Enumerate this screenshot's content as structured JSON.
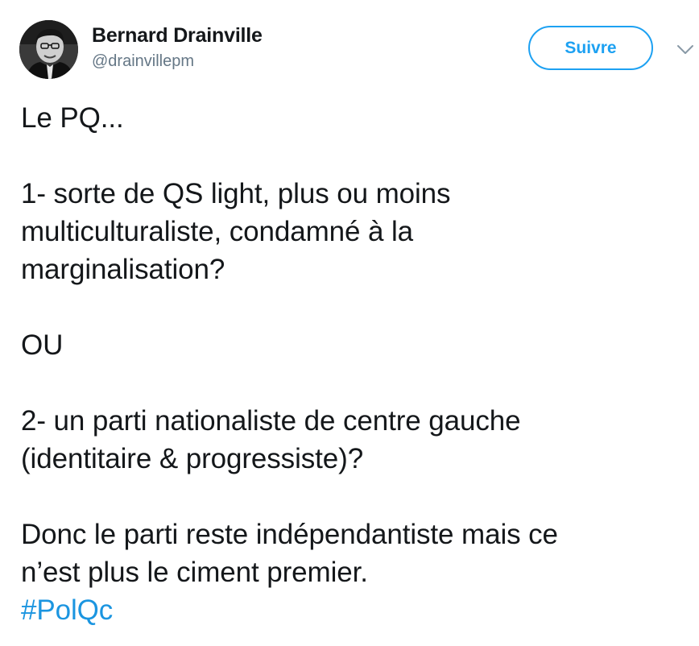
{
  "author": {
    "name": "Bernard Drainville",
    "handle": "@drainvillepm"
  },
  "actions": {
    "follow_label": "Suivre",
    "caret_icon": "chevron-down-icon"
  },
  "tweet": {
    "lines": {
      "l1": "Le PQ...",
      "l2": "1- sorte de QS light, plus ou moins",
      "l3": "multiculturaliste, condamné à la",
      "l4": "marginalisation?",
      "l5": "OU",
      "l6": "2- un parti nationaliste de centre gauche",
      "l7": "(identitaire & progressiste)?",
      "l8": "Donc le parti reste indépendantiste mais ce",
      "l9": "n’est plus le ciment premier."
    },
    "hashtag": "#PolQc"
  },
  "colors": {
    "accent": "#1da1f2",
    "hashtag": "#1b95e0",
    "text": "#14171a",
    "secondary": "#657786"
  }
}
